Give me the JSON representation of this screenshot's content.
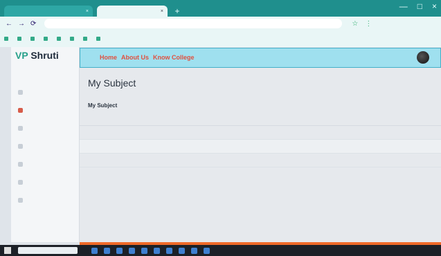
{
  "browser": {
    "tabs": [
      {
        "label": "",
        "close": "×"
      },
      {
        "label": "",
        "close": "×"
      }
    ],
    "new_tab": "+",
    "window_controls": [
      "—",
      "□",
      "×"
    ],
    "nav_buttons": [
      "←",
      "→",
      "⟳"
    ],
    "url": "",
    "toolbar_icons": [
      "☆",
      "⋮"
    ],
    "bookmarks": [
      "",
      "",
      "",
      "",
      "",
      "",
      "",
      ""
    ]
  },
  "sidebar": {
    "brand_vp": "VP",
    "brand_name": "Shruti",
    "brand_sub": "",
    "items": [
      {
        "label": "",
        "active": false
      },
      {
        "label": "",
        "active": true
      },
      {
        "label": "",
        "active": false
      },
      {
        "label": "",
        "active": false
      },
      {
        "label": "",
        "active": false
      },
      {
        "label": "",
        "active": false
      },
      {
        "label": "",
        "active": false
      }
    ]
  },
  "topbar": {
    "nav": [
      "Home",
      "About Us",
      "Know College"
    ],
    "user_name": "",
    "user_role": ""
  },
  "main": {
    "page_title": "My Subject",
    "section_title": "My Subject",
    "table": {
      "headers": [
        "",
        ""
      ],
      "rows": [
        [
          "",
          ""
        ],
        [
          "",
          ""
        ],
        [
          "",
          ""
        ]
      ]
    }
  },
  "taskbar": {
    "search_placeholder": "",
    "tray": ""
  },
  "colors": {
    "accent_teal": "#1f8f8d",
    "topbar_bg": "#9fe0ef",
    "active_red": "#d75c4a",
    "footer_orange": "#f06a2a"
  }
}
